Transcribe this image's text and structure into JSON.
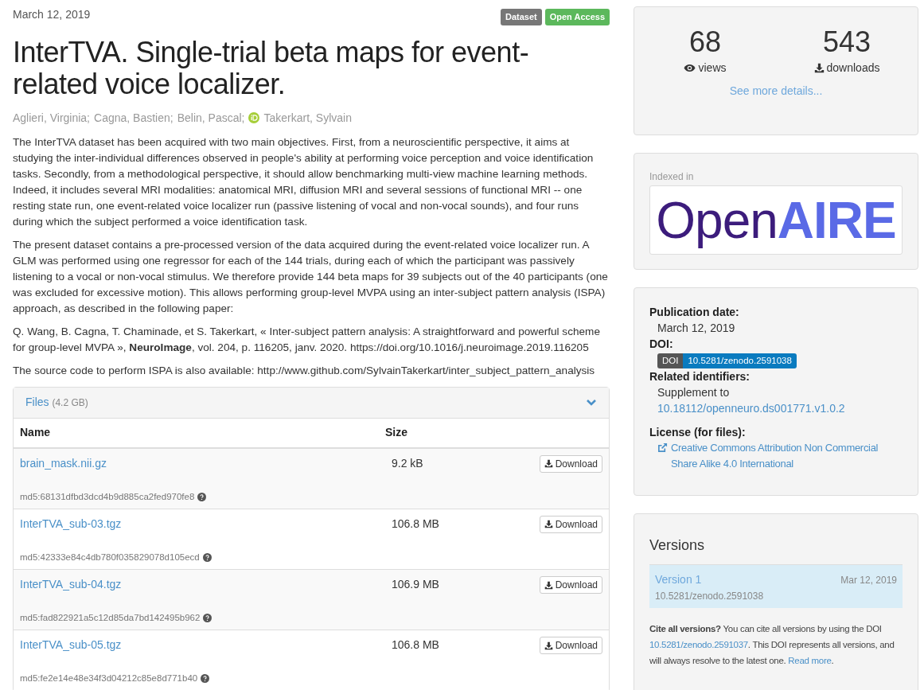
{
  "date": "March 12, 2019",
  "badges": [
    {
      "label": "Dataset",
      "color": "#777777"
    },
    {
      "label": "Open Access",
      "color": "#5cb85c"
    }
  ],
  "title": "InterTVA. Single-trial beta maps for event-related voice localizer.",
  "authors": [
    {
      "name": "Aglieri, Virginia;",
      "orcid": false
    },
    {
      "name": "Cagna, Bastien;",
      "orcid": false
    },
    {
      "name": "Belin, Pascal;",
      "orcid": false
    },
    {
      "name": "Takerkart, Sylvain",
      "orcid": true
    }
  ],
  "description": [
    "The InterTVA dataset has been acquired with two main objectives. First, from a neuroscientific perspective, it aims at studying the inter-individual differences observed in people's ability at performing voice perception and voice identification tasks. Secondly, from a methodological perspective, it should allow benchmarking multi-view machine learning methods. Indeed, it includes several MRI modalities: anatomical MRI, diffusion MRI and several sessions of functional MRI -- one resting state run, one event-related voice localizer run (passive listening of vocal and non-vocal sounds), and four runs during which the subject performed a voice identification task.",
    "The present dataset contains a pre-processed version of the data acquired during the event-related voice localizer run. A GLM was performed using one regressor for each of the 144 trials, during each of which the participant was passively listening to a vocal or non-vocal stimulus. We therefore provide 144 beta maps for 39 subjects out of the 40 participants (one was excluded for excessive motion). This allows performing group-level MVPA using an inter-subject pattern analysis (ISPA) approach, as described in the following paper:",
    "Q. Wang, B. Cagna, T. Chaminade, et S. Takerkart, « Inter-subject pattern analysis: A straightforward and powerful scheme for group-level MVPA », **NeuroImage**, vol. 204, p. 116205, janv. 2020. https://doi.org/10.1016/j.neuroimage.2019.116205",
    "The source code to perform ISPA is also available: http://www.github.com/SylvainTakerkart/inter_subject_pattern_analysis"
  ],
  "files": {
    "title": "Files",
    "size": "(4.2 GB)",
    "expanded": true,
    "columns": [
      "Name",
      "Size"
    ],
    "rows": [
      {
        "name": "brain_mask.nii.gz",
        "size": "9.2 kB",
        "button": "Download",
        "md5": "md5:68131dfbd3dcd4b9d885ca2fed970fe8"
      },
      {
        "name": "InterTVA_sub-03.tgz",
        "size": "106.8 MB",
        "button": "Download",
        "md5": "md5:42333e84c4db780f035829078d105ecd"
      },
      {
        "name": "InterTVA_sub-04.tgz",
        "size": "106.9 MB",
        "button": "Download",
        "md5": "md5:fad822921a5c12d85da7bd142495b962"
      },
      {
        "name": "InterTVA_sub-05.tgz",
        "size": "106.8 MB",
        "button": "Download",
        "md5": "md5:fe2e14e48e34f3d04212c85e8d771b40"
      }
    ]
  },
  "stats": [
    {
      "kind": "views",
      "count": "68",
      "label": "views"
    },
    {
      "kind": "downloads",
      "count": "543",
      "label": "downloads"
    }
  ],
  "stats_link": "See more details...",
  "indexed": {
    "label": "Indexed in",
    "logo_parts": [
      "Open",
      "AIRE"
    ]
  },
  "metadata": {
    "publication_date_label": "Publication date:",
    "publication_date": "March 12, 2019",
    "doi_label": "DOI:",
    "doi_badge": {
      "prefix": "DOI",
      "value": "10.5281/zenodo.2591038"
    },
    "related_label": "Related identifiers:",
    "related_text": "Supplement to",
    "related_link": "10.18112/openneuro.ds001771.v1.0.2",
    "license_label": "License (for files):",
    "license": "Creative Commons Attribution Non Commercial Share Alike 4.0 International"
  },
  "versions": {
    "title": "Versions",
    "items": [
      {
        "name": "Version 1",
        "date": "Mar 12, 2019",
        "doi": "10.5281/zenodo.2591038",
        "selected": true
      }
    ],
    "cite": [
      {
        "kind": "text",
        "text": "**Cite all versions?** You can cite all versions by using the DOI "
      },
      {
        "kind": "link",
        "text": "10.5281/zenodo.2591037"
      },
      {
        "kind": "text",
        "text": ". This DOI represents all versions, and will always resolve to the latest one. "
      },
      {
        "kind": "link",
        "text": "Read more"
      },
      {
        "kind": "text",
        "text": "."
      }
    ]
  }
}
